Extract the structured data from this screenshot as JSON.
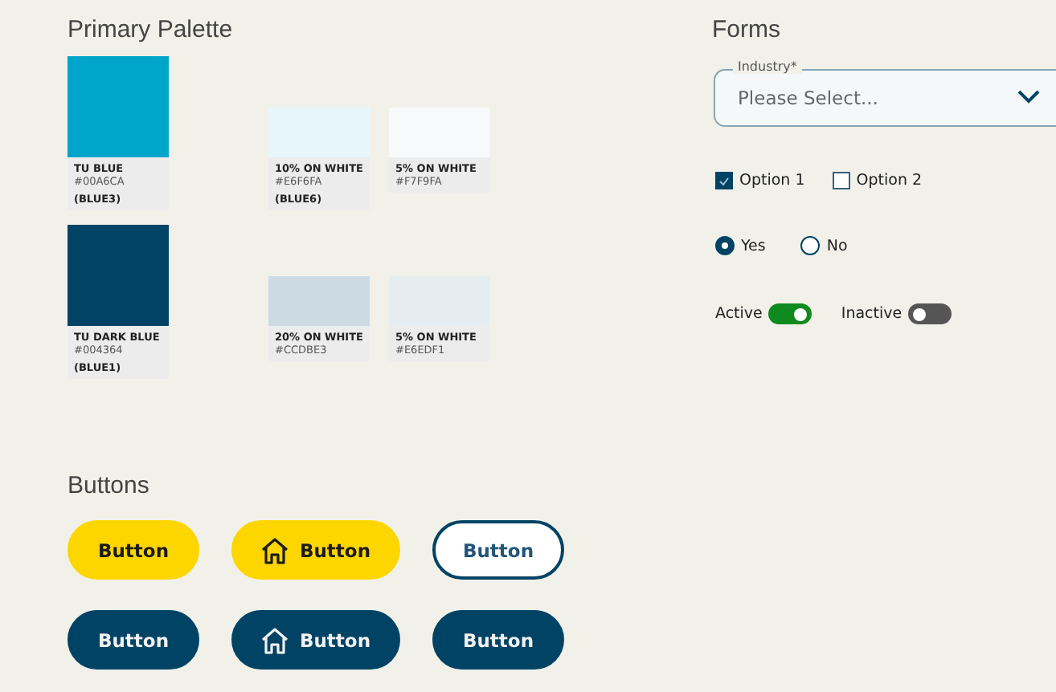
{
  "palette": {
    "title": "Primary Palette",
    "rows": [
      {
        "swatches": [
          {
            "kind": "primary",
            "name": "TU BLUE",
            "hex": "#00A6CA",
            "code": "(BLUE3)",
            "color": "#00a6ca"
          },
          {
            "kind": "tint",
            "name": "10% ON WHITE",
            "hex": "#E6F6FA",
            "code": "(BLUE6)",
            "color": "#e6f6fa"
          },
          {
            "kind": "tint",
            "name": "5% ON WHITE",
            "hex": "#F7F9FA",
            "color": "#f7f9fa"
          }
        ]
      },
      {
        "swatches": [
          {
            "kind": "primary",
            "name": "TU DARK BLUE",
            "hex": "#004364",
            "code": "(BLUE1)",
            "color": "#004364"
          },
          {
            "kind": "tint",
            "name": "20% ON WHITE",
            "hex": "#CCDBE3",
            "color": "#ccdbe3"
          },
          {
            "kind": "tint",
            "name": "5% ON WHITE",
            "hex": "#E6EDF1",
            "color": "#e6edf1"
          }
        ]
      }
    ]
  },
  "buttons": {
    "title": "Buttons",
    "rows": [
      [
        {
          "kind": "yellow",
          "label": "Button",
          "icon": false
        },
        {
          "kind": "yellow",
          "label": "Button",
          "icon": true
        },
        {
          "kind": "outline",
          "label": "Button",
          "icon": false
        }
      ],
      [
        {
          "kind": "dark",
          "label": "Button",
          "icon": false
        },
        {
          "kind": "dark",
          "label": "Button",
          "icon": true
        },
        {
          "kind": "dark",
          "label": "Button",
          "icon": false
        }
      ]
    ]
  },
  "forms": {
    "title": "Forms",
    "dropdown": {
      "label": "Industry*",
      "placeholder": "Please Select..."
    },
    "checkboxes": [
      {
        "label": "Option 1",
        "checked": true
      },
      {
        "label": "Option 2",
        "checked": false
      }
    ],
    "radios": [
      {
        "label": "Yes",
        "selected": true
      },
      {
        "label": "No",
        "selected": false
      }
    ],
    "toggles": [
      {
        "label": "Active",
        "on": true
      },
      {
        "label": "Inactive",
        "on": false
      }
    ]
  }
}
